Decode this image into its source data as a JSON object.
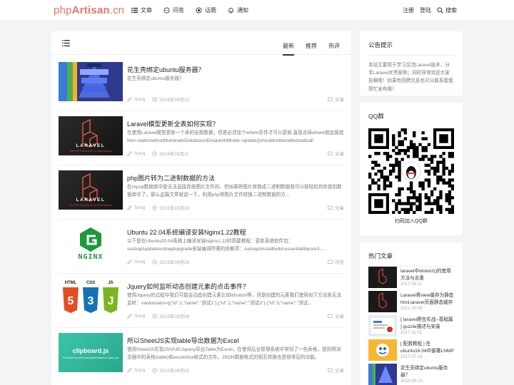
{
  "nav": {
    "logo_php": "php",
    "logo_artisan": "Artisan",
    "logo_cn": ".cn",
    "items": [
      {
        "label": "文章",
        "icon": "list-icon"
      },
      {
        "label": "问答",
        "icon": "chat-icon"
      },
      {
        "label": "话题",
        "icon": "target-icon"
      },
      {
        "label": "通知",
        "icon": "bell-icon"
      }
    ],
    "register": "注册",
    "login": "登陆",
    "search": "搜索"
  },
  "main": {
    "tabs": [
      {
        "label": "最新",
        "active": true
      },
      {
        "label": "推荐",
        "active": false
      },
      {
        "label": "热评",
        "active": false
      }
    ],
    "articles": [
      {
        "title": "花生壳绑定ubuntu服务器？",
        "desc": "花生壳绑定ubuntu服务器？",
        "author": "Song",
        "date": "2024年09月23",
        "category": "文章",
        "thumb": "pyramid"
      },
      {
        "title": "Laravel模型更新全表如何实现？",
        "desc": "在使用Laravel模型更新一个表的全部数据，但是必须加个where条件才可以更新,直接去掉where就会报错Non-staticmethodIlluminate\\Database\\Eloquent\\Model::update()shouldnotbecalledstaticall",
        "author": "Song",
        "date": "2024年03月11",
        "category": "文章",
        "thumb": "laravel"
      },
      {
        "title": "php图片转为二进制数据的方法",
        "desc": "在mysql数据库中是无法直接存放图片文件的，但如果将图片转换成二进制数据就可以很轻松的存放到数据库中了。那么这篇文章就说一下，利用php将图片文件转换二进制数据的方...",
        "author": "Song",
        "date": "2023年10月23",
        "category": "文章",
        "thumb": "laravel"
      },
      {
        "title": "Ubuntu 22.04系统编译安装Nginx1.22教程",
        "desc": "以下是在Ubuntu20.04系统上编译安装Nginx1.22的简要教程：更新系统软件包：sudoaptupdatesudoaptupgrade安装编译所需的依赖项：sudoaptinstallbuild-essentiallibpcre3-...",
        "author": "Song",
        "date": "2023年09月26",
        "category": "问答",
        "thumb": "nginx"
      },
      {
        "title": "Jquery如何监听动态创建元素的点击事件？",
        "desc": "使用Jquery的过程中我们可能会动态创建元素比如li/button等，但是创建的元素我们使用如下方法则无法监听：vardomains=[{\"id\":1,\"name\":\"测试1\"},{\"id\":2,\"name\":\"测试2\"},{\"id\":3,\"name\":\"测试...",
        "author": "Song",
        "date": "2023年09月08",
        "category": "文章",
        "thumb": "html5"
      },
      {
        "title": "所以SheetJS实现table导出数据为Excel",
        "desc": "使用SheetJS实现JS/VUE/Jquery导出Table为Excel，在使用后台管理系统中常到了一些表格，想到得浏览器中的表格(table)和excel/xlsx格式的文件。JSON数据格式的相互转换也是很常见的功能。",
        "author": "Song",
        "date": "2023年08月05",
        "category": "文章",
        "thumb": "clipboard"
      }
    ],
    "thumb_text": {
      "laravel": "LARAVEL",
      "laravel_sub": "The PHP Framework For Web Artisans",
      "nginx": "NGINX",
      "clipboard": "clipboard.js",
      "clipboard_sub": "Put those innocent copy/paste buttons to good use",
      "html": "HTML",
      "css": "CSS",
      "js": "JS"
    }
  },
  "sidebar": {
    "notice_title": "公告提示",
    "notice_text": "本站主要用于学习交流Laravel技术，分享Laravel优秀案例；同时非常欢迎大家投稿哦！如果有回聘信息也可以联系我我帮忙发布哦！",
    "qq_title": "QQ群",
    "qq_caption": "扫码加入QQ群",
    "hot_title": "热门文章",
    "hot": [
      {
        "title": "laravel中distinct()的使用方法与去重",
        "date": "2017-09-11",
        "thumb": "laravel"
      },
      {
        "title": "Laravel将view缓存为静态html,laravel页面静态缓存",
        "date": "2021-10-09",
        "thumb": "laravel"
      },
      {
        "title": "[ laravel爬虫实战--基础篇 ] guzzle描述与安装",
        "date": "2017-11-01",
        "thumb": "guzzle"
      },
      {
        "title": "[ 配置教程 ] 在ubuntu16.04中部署LNMP环境",
        "date": "2017-07-18",
        "thumb": "baidu"
      },
      {
        "title": "花生壳绑定ubuntu服务器？",
        "date": "2024-09-23",
        "thumb": "pyramid"
      }
    ]
  },
  "colors": {
    "brand": "#e8756a",
    "laravel_red": "#f05340",
    "nginx_green": "#199a3b"
  }
}
